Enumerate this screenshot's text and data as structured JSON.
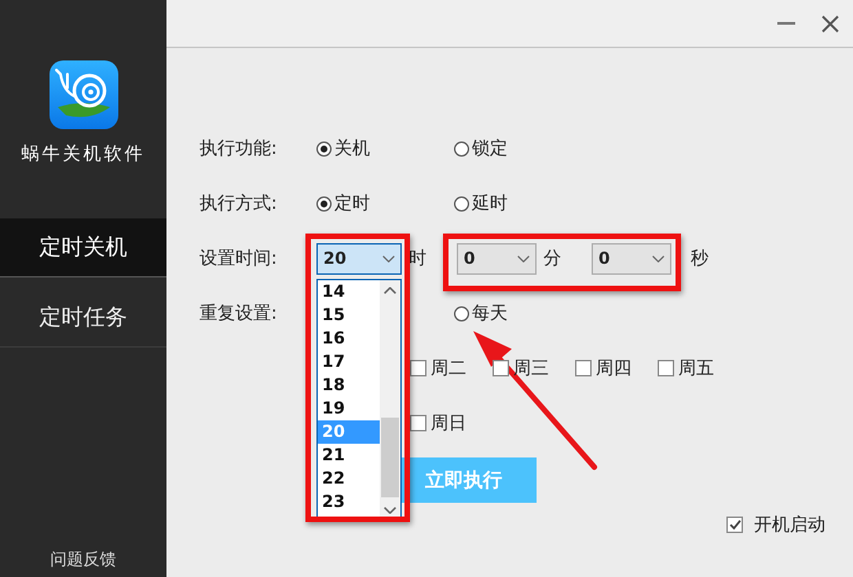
{
  "sidebar": {
    "app_name": "蜗牛关机软件",
    "items": [
      {
        "label": "定时关机",
        "selected": true
      },
      {
        "label": "定时任务",
        "selected": false
      }
    ],
    "feedback": "问题反馈"
  },
  "form": {
    "function": {
      "label": "执行功能:",
      "options": [
        {
          "label": "关机",
          "selected": true
        },
        {
          "label": "锁定",
          "selected": false
        }
      ]
    },
    "mode": {
      "label": "执行方式:",
      "options": [
        {
          "label": "定时",
          "selected": true
        },
        {
          "label": "延时",
          "selected": false
        }
      ]
    },
    "time": {
      "label": "设置时间:",
      "fields": [
        {
          "value": "20",
          "unit": "时",
          "focused": true
        },
        {
          "value": "0",
          "unit": "分",
          "focused": false
        },
        {
          "value": "0",
          "unit": "秒",
          "focused": false
        }
      ]
    },
    "repeat": {
      "label": "重复设置:",
      "options": [
        {
          "label": "每天",
          "selected": false
        }
      ]
    },
    "weekday_rows": [
      [
        {
          "label": "周二",
          "checked": false
        },
        {
          "label": "周三",
          "checked": false
        },
        {
          "label": "周四",
          "checked": false
        },
        {
          "label": "周五",
          "checked": false
        }
      ],
      [
        {
          "label": "周日",
          "checked": false
        }
      ]
    ],
    "run_button": "立即执行",
    "autostart": {
      "label": "开机启动",
      "checked": true
    }
  },
  "hour_dropdown": {
    "items": [
      {
        "label": "14",
        "selected": false
      },
      {
        "label": "15",
        "selected": false
      },
      {
        "label": "16",
        "selected": false
      },
      {
        "label": "17",
        "selected": false
      },
      {
        "label": "18",
        "selected": false
      },
      {
        "label": "19",
        "selected": false
      },
      {
        "label": "20",
        "selected": true
      },
      {
        "label": "21",
        "selected": false
      },
      {
        "label": "22",
        "selected": false
      },
      {
        "label": "23",
        "selected": false
      }
    ]
  },
  "annotations": [
    {
      "kind": "box"
    },
    {
      "kind": "box"
    },
    {
      "kind": "arrow"
    }
  ]
}
